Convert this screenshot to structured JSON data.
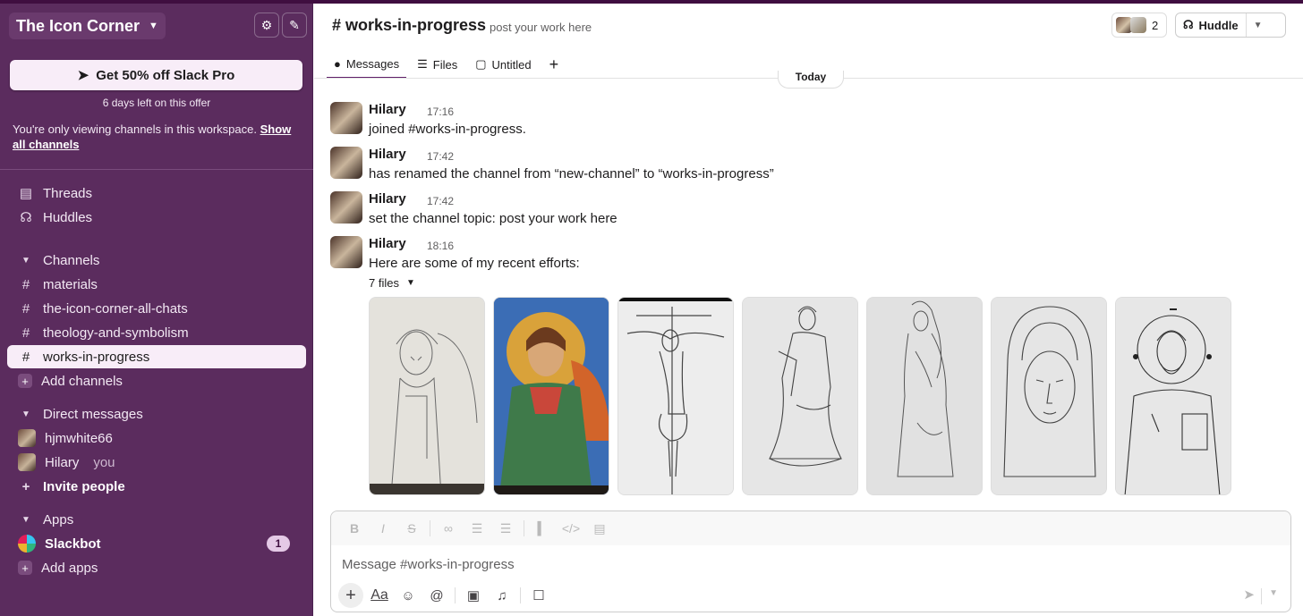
{
  "workspace": {
    "name": "The Icon Corner"
  },
  "promo": {
    "label": "Get 50% off Slack Pro",
    "subtext": "6 days left on this offer"
  },
  "viewing_notice": {
    "text": "You're only viewing channels in this workspace. ",
    "link": "Show all channels"
  },
  "nav": {
    "threads": "Threads",
    "huddles": "Huddles"
  },
  "channels": {
    "header": "Channels",
    "items": [
      "materials",
      "the-icon-corner-all-chats",
      "theology-and-symbolism",
      "works-in-progress"
    ],
    "active": "works-in-progress",
    "add_label": "Add channels"
  },
  "dms": {
    "header": "Direct messages",
    "items": [
      {
        "name": "hjmwhite66",
        "suffix": ""
      },
      {
        "name": "Hilary",
        "suffix": "you"
      }
    ],
    "invite_label": "Invite people"
  },
  "apps": {
    "header": "Apps",
    "slackbot": {
      "name": "Slackbot",
      "badge": "1"
    },
    "add_label": "Add apps"
  },
  "channel": {
    "title": "# works-in-progress",
    "topic": "post your work here",
    "member_count": "2",
    "huddle_label": "Huddle",
    "tabs": [
      "Messages",
      "Files",
      "Untitled"
    ],
    "today_label": "Today"
  },
  "messages": [
    {
      "author": "Hilary",
      "time": "17:16",
      "text": "joined #works-in-progress."
    },
    {
      "author": "Hilary",
      "time": "17:42",
      "text": "has renamed the channel from “new-channel” to “works-in-progress”"
    },
    {
      "author": "Hilary",
      "time": "17:42",
      "text": "set the channel topic: post your work here"
    },
    {
      "author": "Hilary",
      "time": "18:16",
      "text": "Here are some of my recent efforts:"
    }
  ],
  "files": {
    "toggle_label": "7 files",
    "items": [
      {
        "desc": "angel-pencil-sketch"
      },
      {
        "desc": "angel-painted-icon"
      },
      {
        "desc": "crucifixion-sketch"
      },
      {
        "desc": "saint-john-sketch"
      },
      {
        "desc": "virgin-mary-standing-sketch"
      },
      {
        "desc": "virgin-mary-face-sketch"
      },
      {
        "desc": "christ-pantocrator-sketch"
      }
    ]
  },
  "composer": {
    "placeholder": "Message #works-in-progress"
  },
  "colors": {
    "sidebar_bg": "#5b2c5e",
    "accent": "#611f69",
    "active_item_bg": "#f8edf8",
    "painted_icon_gold": "#d9a23a",
    "painted_icon_blue": "#3b6db5",
    "painted_icon_green": "#3f7a4a"
  }
}
